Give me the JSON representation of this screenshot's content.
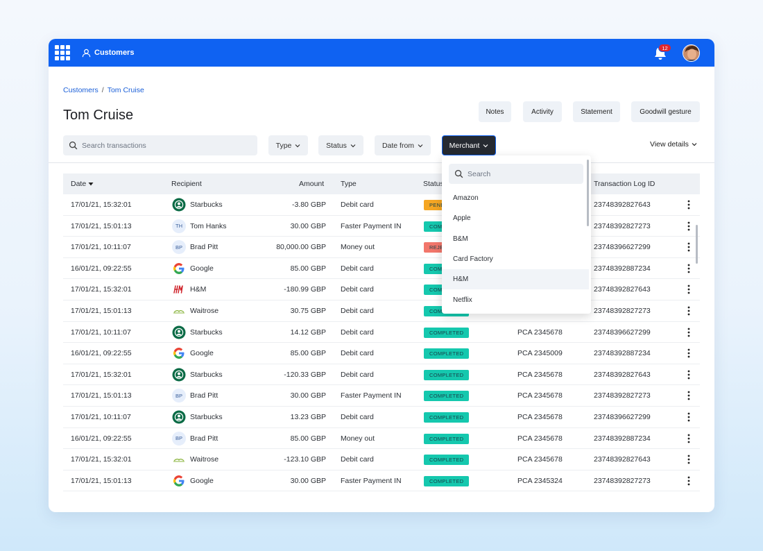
{
  "topbar": {
    "nav_label": "Customers",
    "notification_count": "12"
  },
  "breadcrumb": {
    "root": "Customers",
    "separator": "/",
    "current": "Tom Cruise"
  },
  "page_title": "Tom Cruise",
  "actions": {
    "notes": "Notes",
    "activity": "Activity",
    "statement": "Statement",
    "goodwill": "Goodwill gesture"
  },
  "filters": {
    "search_placeholder": "Search transactions",
    "type": "Type",
    "status": "Status",
    "date_from": "Date from",
    "merchant": "Merchant",
    "view_details": "View details"
  },
  "table": {
    "headers": {
      "date": "Date",
      "recipient": "Recipient",
      "amount": "Amount",
      "type": "Type",
      "status": "Status",
      "transaction_log_id": "Transaction Log ID"
    },
    "rows": [
      {
        "date": "17/01/21, 15:32:01",
        "recipient": "Starbucks",
        "logo": "starbucks",
        "amount": "-3.80 GBP",
        "type": "Debit card",
        "status": "PENDING",
        "status_color": "#f5a623",
        "ref": "",
        "log_id": "23748392827643"
      },
      {
        "date": "17/01/21, 15:01:13",
        "recipient": "Tom Hanks",
        "logo": "initials",
        "initials": "TH",
        "amount": "30.00 GBP",
        "type": "Faster Payment IN",
        "status": "COMPLETED",
        "status_color": "#15c8ae",
        "ref": "",
        "log_id": "23748392827273"
      },
      {
        "date": "17/01/21, 10:11:07",
        "recipient": "Brad Pitt",
        "logo": "initials",
        "initials": "BP",
        "amount": "80,000.00 GBP",
        "type": "Money out",
        "status": "REJECTED",
        "status_color": "#f2766b",
        "ref": "",
        "log_id": "23748396627299"
      },
      {
        "date": "16/01/21, 09:22:55",
        "recipient": "Google",
        "logo": "google",
        "amount": "85.00 GBP",
        "type": "Debit card",
        "status": "COMPLETED",
        "status_color": "#15c8ae",
        "ref": "",
        "log_id": "23748392887234"
      },
      {
        "date": "17/01/21, 15:32:01",
        "recipient": "H&M",
        "logo": "hm",
        "amount": "-180.99 GBP",
        "type": "Debit card",
        "status": "COMPLETED",
        "status_color": "#15c8ae",
        "ref": "",
        "log_id": "23748392827643"
      },
      {
        "date": "17/01/21, 15:01:13",
        "recipient": "Waitrose",
        "logo": "waitrose",
        "amount": "30.75 GBP",
        "type": "Debit card",
        "status": "COMPLETED",
        "status_color": "#15c8ae",
        "ref": "",
        "log_id": "23748392827273"
      },
      {
        "date": "17/01/21, 10:11:07",
        "recipient": "Starbucks",
        "logo": "starbucks",
        "amount": "14.12 GBP",
        "type": "Debit card",
        "status": "COMPLETED",
        "status_color": "#15c8ae",
        "ref": "PCA 2345678",
        "log_id": "23748396627299"
      },
      {
        "date": "16/01/21, 09:22:55",
        "recipient": "Google",
        "logo": "google",
        "amount": "85.00 GBP",
        "type": "Debit card",
        "status": "COMPLETED",
        "status_color": "#15c8ae",
        "ref": "PCA 2345009",
        "log_id": "23748392887234"
      },
      {
        "date": "17/01/21, 15:32:01",
        "recipient": "Starbucks",
        "logo": "starbucks",
        "amount": "-120.33 GBP",
        "type": "Debit card",
        "status": "COMPLETED",
        "status_color": "#15c8ae",
        "ref": "PCA 2345678",
        "log_id": "23748392827643"
      },
      {
        "date": "17/01/21, 15:01:13",
        "recipient": "Brad Pitt",
        "logo": "initials",
        "initials": "BP",
        "amount": "30.00 GBP",
        "type": "Faster Payment IN",
        "status": "COMPLETED",
        "status_color": "#15c8ae",
        "ref": "PCA 2345678",
        "log_id": "23748392827273"
      },
      {
        "date": "17/01/21, 10:11:07",
        "recipient": "Starbucks",
        "logo": "starbucks",
        "amount": "13.23 GBP",
        "type": "Debit card",
        "status": "COMPLETED",
        "status_color": "#15c8ae",
        "ref": "PCA 2345678",
        "log_id": "23748396627299"
      },
      {
        "date": "16/01/21, 09:22:55",
        "recipient": "Brad Pitt",
        "logo": "initials",
        "initials": "BP",
        "amount": "85.00 GBP",
        "type": "Money out",
        "status": "COMPLETED",
        "status_color": "#15c8ae",
        "ref": "PCA 2345678",
        "log_id": "23748392887234"
      },
      {
        "date": "17/01/21, 15:32:01",
        "recipient": "Waitrose",
        "logo": "waitrose",
        "amount": "-123.10 GBP",
        "type": "Debit card",
        "status": "COMPLETED",
        "status_color": "#15c8ae",
        "ref": "PCA 2345678",
        "log_id": "23748392827643"
      },
      {
        "date": "17/01/21, 15:01:13",
        "recipient": "Google",
        "logo": "google",
        "amount": "30.00 GBP",
        "type": "Faster Payment IN",
        "status": "COMPLETED",
        "status_color": "#15c8ae",
        "ref": "PCA 2345324",
        "log_id": "23748392827273"
      }
    ]
  },
  "merchant_dropdown": {
    "search_placeholder": "Search",
    "items": [
      "Amazon",
      "Apple",
      "B&M",
      "Card Factory",
      "H&M",
      "Netflix"
    ],
    "hovered": "H&M"
  },
  "colors": {
    "brand_blue": "#0f62f2",
    "completed": "#15c8ae",
    "pending": "#f5a623",
    "rejected": "#f2766b"
  },
  "icons": [
    "grid-icon",
    "user-icon",
    "bell-icon",
    "search-icon",
    "chevron-down-icon",
    "sort-down-icon",
    "kebab-icon"
  ]
}
